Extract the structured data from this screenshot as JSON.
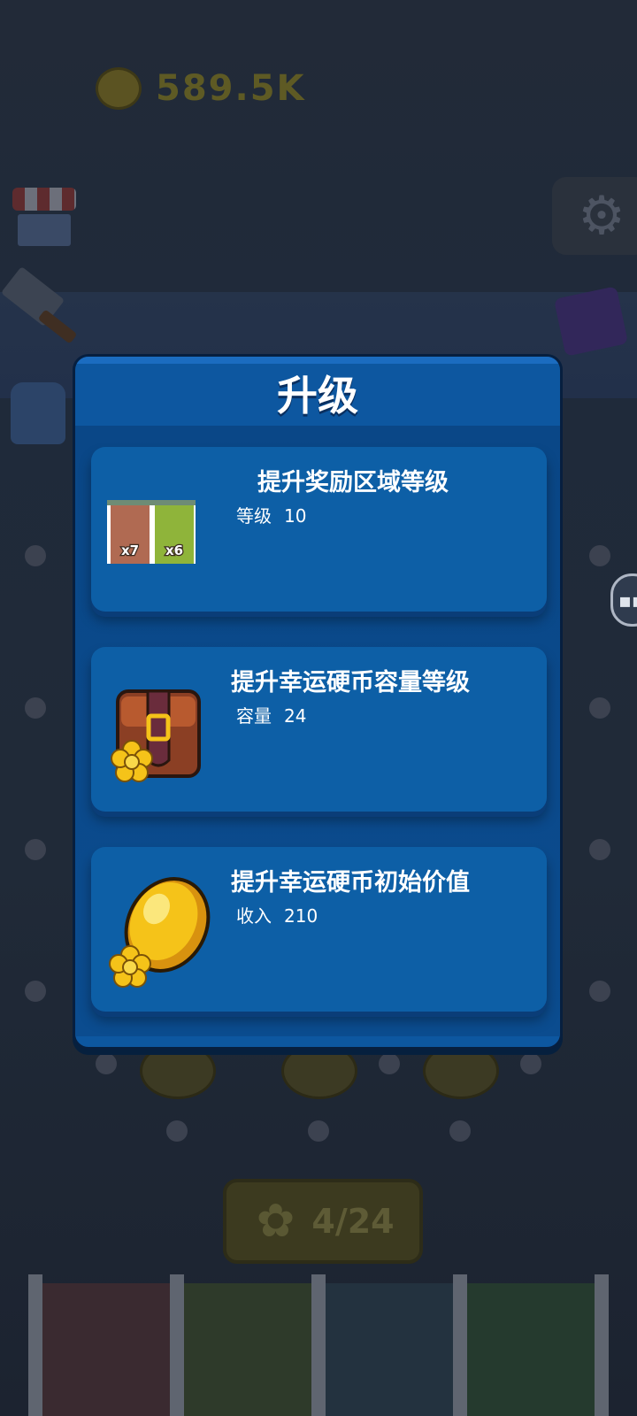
{
  "hud": {
    "coins": "589.5K"
  },
  "counter": {
    "text": "4/24"
  },
  "modal": {
    "title": "升级",
    "cards": [
      {
        "title": "提升奖励区域等级",
        "stat_label": "等级",
        "stat_value": "10",
        "tiles": [
          "x7",
          "x6"
        ]
      },
      {
        "title": "提升幸运硬币容量等级",
        "stat_label": "容量",
        "stat_value": "24"
      },
      {
        "title": "提升幸运硬币初始价值",
        "stat_label": "收入",
        "stat_value": "210"
      }
    ]
  },
  "colors": {
    "modal_bg": "#0d57a0",
    "card_bg": "#0d5fa6",
    "tile_brown": "#b06a52",
    "tile_green": "#8fb43a",
    "gold": "#f5c319"
  },
  "icons": [
    "shop-icon",
    "hammer-icon",
    "potion-icon",
    "gear-icon",
    "book-icon",
    "chat-icon",
    "chest-icon",
    "gold-coin-icon",
    "flower-icon"
  ]
}
